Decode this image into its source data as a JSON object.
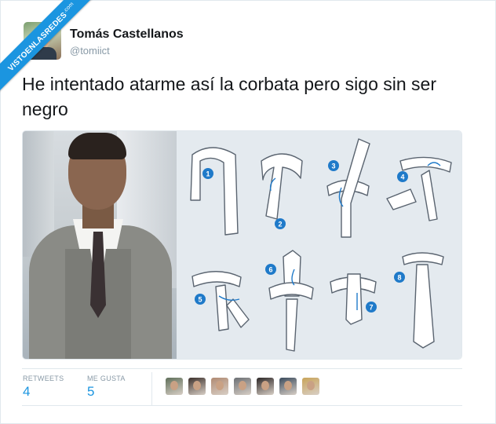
{
  "watermark": {
    "text": "VISTOENLASREDES",
    "suffix": ".com"
  },
  "tweet": {
    "author_name": "Tomás Castellanos",
    "author_handle": "@tomiict",
    "text": "He intentado atarme así la corbata pero sigo sin ser negro"
  },
  "diagram": {
    "steps": [
      "1",
      "2",
      "3",
      "4",
      "5",
      "6",
      "7",
      "8"
    ],
    "step_color": "#1f7ac9"
  },
  "stats": {
    "retweets_label": "RETWEETS",
    "retweets_value": "4",
    "likes_label": "ME GUSTA",
    "likes_value": "5"
  },
  "likers": [
    {
      "name": "liker-avatar-1",
      "color": "#5f6f5a"
    },
    {
      "name": "liker-avatar-2",
      "color": "#3b2f2a"
    },
    {
      "name": "liker-avatar-3",
      "color": "#b08a72"
    },
    {
      "name": "liker-avatar-4",
      "color": "#6b6f74"
    },
    {
      "name": "liker-avatar-5",
      "color": "#2c2626"
    },
    {
      "name": "liker-avatar-6",
      "color": "#3a4a5c"
    },
    {
      "name": "liker-avatar-7",
      "color": "#c9a45a"
    }
  ],
  "colors": {
    "accent": "#1b95e0",
    "name": "#14171a",
    "muted": "#8899a6"
  }
}
